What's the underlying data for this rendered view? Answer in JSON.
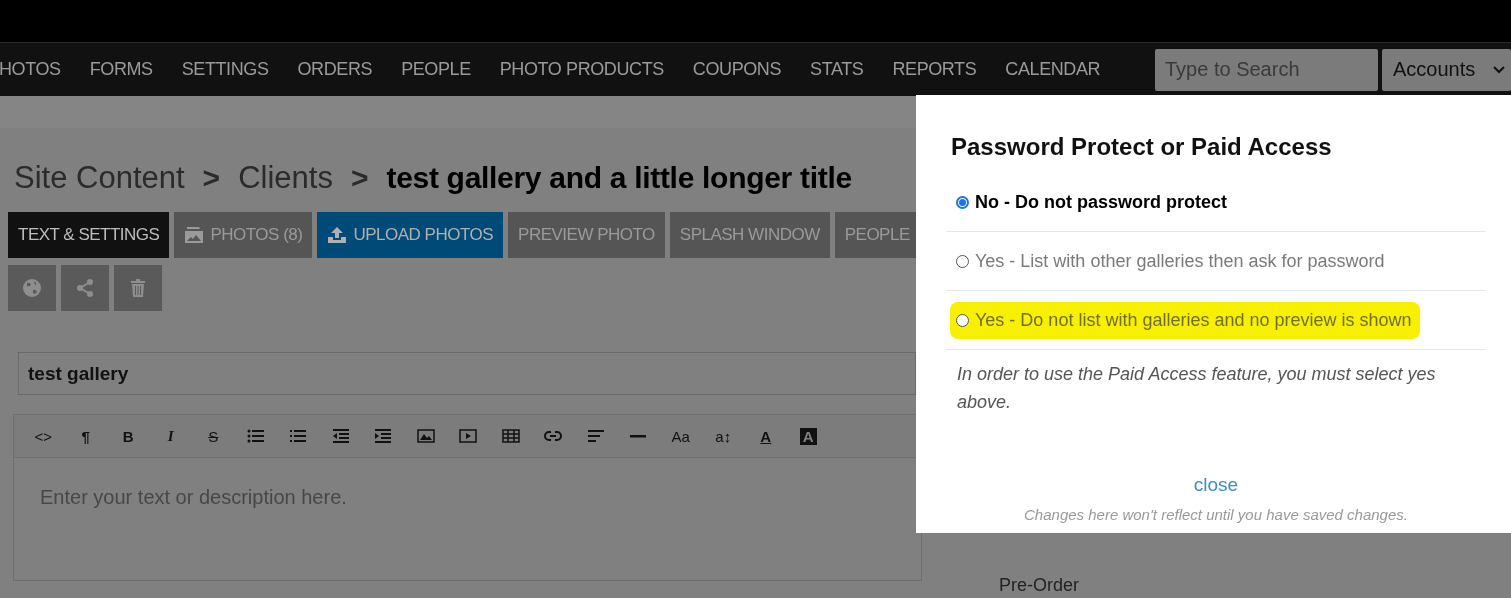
{
  "nav": {
    "items": [
      "HOTOS",
      "FORMS",
      "SETTINGS",
      "ORDERS",
      "PEOPLE",
      "PHOTO PRODUCTS",
      "COUPONS",
      "STATS",
      "REPORTS",
      "CALENDAR"
    ],
    "search": {
      "placeholder": "Type to Search"
    },
    "accounts": "Accounts"
  },
  "breadcrumb": {
    "items": [
      "Site Content",
      "Clients"
    ],
    "separator": ">",
    "current": "test gallery and a little longer title"
  },
  "tabs": [
    {
      "label": "TEXT & SETTINGS",
      "kind": "plain",
      "selected": true
    },
    {
      "label": "PHOTOS (8)",
      "kind": "photos",
      "selected": false
    },
    {
      "label": "UPLOAD PHOTOS",
      "kind": "upload",
      "selected": false
    },
    {
      "label": "PREVIEW PHOTO",
      "kind": "plain",
      "selected": false
    },
    {
      "label": "SPLASH WINDOW",
      "kind": "plain",
      "selected": false
    },
    {
      "label": "PEOPLE",
      "kind": "plain",
      "selected": false
    }
  ],
  "title_field": {
    "value": "test gallery"
  },
  "toolbar": [
    {
      "kind": "code",
      "text": "<>"
    },
    {
      "kind": "paragraph",
      "text": "¶"
    },
    {
      "kind": "bold",
      "text": "B"
    },
    {
      "kind": "italic",
      "text": "I"
    },
    {
      "kind": "strike",
      "text": "S"
    },
    {
      "kind": "bullets"
    },
    {
      "kind": "numbers"
    },
    {
      "kind": "outdent"
    },
    {
      "kind": "indent"
    },
    {
      "kind": "image"
    },
    {
      "kind": "video"
    },
    {
      "kind": "table"
    },
    {
      "kind": "link"
    },
    {
      "kind": "align"
    },
    {
      "kind": "rule"
    },
    {
      "kind": "size",
      "text": "Aa"
    },
    {
      "kind": "spacing",
      "text": "a↕"
    },
    {
      "kind": "color",
      "text": "A"
    },
    {
      "kind": "background",
      "text": "A"
    }
  ],
  "editor": {
    "placeholder": "Enter your text or description here."
  },
  "side_list": [
    "Pre-Order"
  ],
  "modal": {
    "title": "Password Protect or Paid Access",
    "options": [
      {
        "label": "No - Do not password protect",
        "selected": true,
        "highlighted": false
      },
      {
        "label": "Yes - List with other galleries then ask for password",
        "selected": false,
        "highlighted": false
      },
      {
        "label": "Yes - Do not list with galleries and no preview is shown",
        "selected": false,
        "highlighted": true
      }
    ],
    "note": "In order to use the Paid Access feature, you must select yes above.",
    "close": "close",
    "footnote": "Changes here won't reflect until you have saved changes."
  }
}
